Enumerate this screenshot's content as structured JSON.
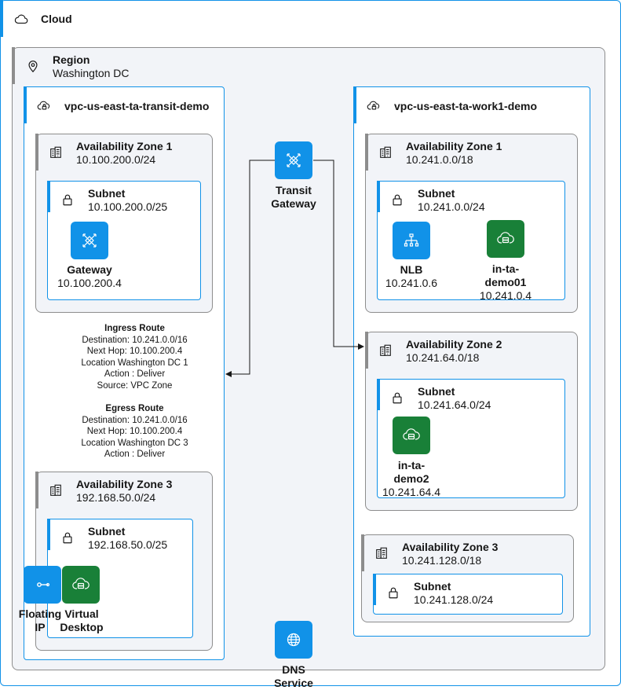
{
  "cloud": {
    "title": "Cloud",
    "icon": "cloud-icon"
  },
  "region": {
    "title": "Region",
    "name": "Washington DC",
    "icon": "location-icon"
  },
  "transit_vpc": {
    "name": "vpc-us-east-ta-transit-demo",
    "zone1": {
      "title": "Availability Zone 1",
      "cidr": "10.100.200.0/24",
      "subnet": {
        "title": "Subnet",
        "cidr": "10.100.200.0/25"
      },
      "gateway": {
        "name": "Gateway",
        "ip": "10.100.200.4"
      }
    },
    "ingress": {
      "title": "Ingress Route",
      "lines": [
        "Destination: 10.241.0.0/16",
        "Next Hop: 10.100.200.4",
        "Location Washington DC 1",
        "Action : Deliver",
        "Source: VPC Zone"
      ]
    },
    "egress": {
      "title": "Egress Route",
      "lines": [
        "Destination: 10.241.0.0/16",
        "Next Hop: 10.100.200.4",
        "Location Washington DC 3",
        "Action : Deliver"
      ]
    },
    "zone3": {
      "title": "Availability Zone 3",
      "cidr": "192.168.50.0/24",
      "subnet": {
        "title": "Subnet",
        "cidr": "192.168.50.0/25"
      },
      "floating_ip": [
        "Floating",
        "IP"
      ],
      "virtual_desktop": [
        "Virtual",
        "Desktop"
      ]
    }
  },
  "transit_gateway": [
    "Transit",
    "Gateway"
  ],
  "dns_service": [
    "DNS",
    "Service"
  ],
  "work_vpc": {
    "name": "vpc-us-east-ta-work1-demo",
    "zone1": {
      "title": "Availability Zone 1",
      "cidr": "10.241.0.0/18",
      "subnet": {
        "title": "Subnet",
        "cidr": "10.241.0.0/24"
      },
      "nlb": {
        "name": "NLB",
        "ip": "10.241.0.6"
      },
      "server": {
        "name": [
          "in-ta-",
          "demo01"
        ],
        "ip": "10.241.0.4"
      }
    },
    "zone2": {
      "title": "Availability Zone 2",
      "cidr": "10.241.64.0/18",
      "subnet": {
        "title": "Subnet",
        "cidr": "10.241.64.0/24"
      },
      "server": {
        "name": [
          "in-ta-",
          "demo2"
        ],
        "ip": "10.241.64.4"
      }
    },
    "zone3": {
      "title": "Availability Zone 3",
      "cidr": "10.241.128.0/18",
      "subnet": {
        "title": "Subnet",
        "cidr": "10.241.128.0/24"
      }
    }
  },
  "colors": {
    "accent_blue": "#1192e8",
    "group_gray": "#8d8d8d",
    "server_green": "#198038",
    "zone_fill": "#f2f4f8"
  }
}
